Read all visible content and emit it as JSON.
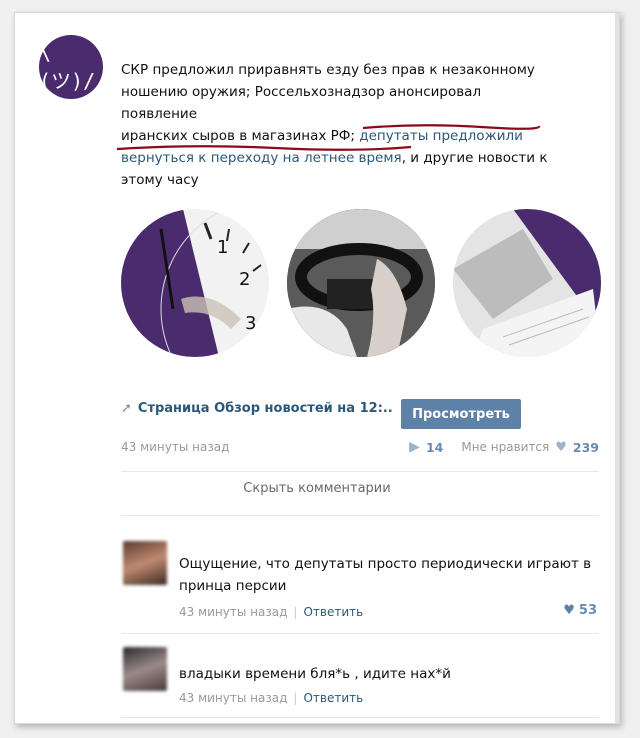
{
  "post": {
    "avatar_glyph": "\\(ツ)/",
    "text_line1": "СКР предложил приравнять езду без прав к незаконному",
    "text_line2": "ношению оружия; Россельхознадзор анонсировал появление",
    "text_line3a": "иранских сыров в магазинах РФ; ",
    "text_line3b": "депутаты предложили",
    "text_line4a": "вернуться к переходу на летнее время",
    "text_line4b": ", и другие новости к",
    "text_line5": "этому часу"
  },
  "attachment": {
    "page_label": "Страница Обзор новостей на 12:..",
    "view_button": "Просмотреть"
  },
  "meta": {
    "time": "43 минуты назад",
    "shares": "14",
    "likes_label": "Мне нравится",
    "likes": "239"
  },
  "hide_comments": "Скрыть комментарии",
  "comments": [
    {
      "line1": "Ощущение, что депутаты просто периодически играют в",
      "line2": "принца персии",
      "time": "43 минуты назад",
      "reply": "Ответить",
      "likes": "53"
    },
    {
      "line1": "владыки времени бля*ь , идите нах*й",
      "time": "43 минуты назад",
      "reply": "Ответить"
    }
  ],
  "colors": {
    "brand_purple": "#4a2c6e",
    "link_blue": "#2b587a",
    "button_blue": "#5e81a8",
    "underline_red": "#8b0a1a"
  }
}
